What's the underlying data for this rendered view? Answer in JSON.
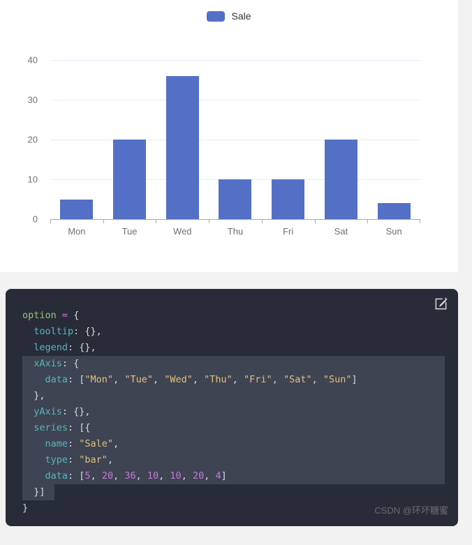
{
  "page": {
    "background": "#f2f2f2",
    "card_background": "#ffffff",
    "code_background": "#282c38",
    "selection_color": "#3e4452",
    "accent": "#5470c6"
  },
  "chart_data": {
    "type": "bar",
    "title": "",
    "subtitle": "",
    "xlabel": "",
    "ylabel": "",
    "categories": [
      "Mon",
      "Tue",
      "Wed",
      "Thu",
      "Fri",
      "Sat",
      "Sun"
    ],
    "series": [
      {
        "name": "Sale",
        "values": [
          5,
          20,
          36,
          10,
          10,
          20,
          4
        ],
        "color": "#5470c6"
      }
    ],
    "ylim": [
      0,
      40
    ],
    "yticks": [
      0,
      10,
      20,
      30,
      40
    ],
    "ytick_labels": [
      "0",
      "10",
      "20",
      "30",
      "40"
    ],
    "grid": true,
    "legend_position": "top-center",
    "legend_entries": [
      "Sale"
    ]
  },
  "legend": {
    "label": "Sale"
  },
  "code_editor": {
    "edit_icon": "edit-square-icon",
    "watermark": "CSDN @环坏糖蜜",
    "lines": [
      {
        "selected": false,
        "tokens": [
          {
            "t": "option",
            "c": "tok-var"
          },
          {
            "t": " ",
            "c": "tok-punct"
          },
          {
            "t": "=",
            "c": "tok-op"
          },
          {
            "t": " {",
            "c": "tok-brace"
          }
        ]
      },
      {
        "selected": false,
        "tokens": [
          {
            "t": "  ",
            "c": "tok-punct"
          },
          {
            "t": "tooltip",
            "c": "tok-key"
          },
          {
            "t": ": {},",
            "c": "tok-brace"
          }
        ]
      },
      {
        "selected": false,
        "tokens": [
          {
            "t": "  ",
            "c": "tok-punct"
          },
          {
            "t": "legend",
            "c": "tok-key"
          },
          {
            "t": ": {},",
            "c": "tok-brace"
          }
        ]
      },
      {
        "selected": true,
        "tokens": [
          {
            "t": "  ",
            "c": "tok-punct"
          },
          {
            "t": "xAxis",
            "c": "tok-key"
          },
          {
            "t": ": {",
            "c": "tok-brace"
          }
        ]
      },
      {
        "selected": true,
        "tokens": [
          {
            "t": "    ",
            "c": "tok-punct"
          },
          {
            "t": "data",
            "c": "tok-key"
          },
          {
            "t": ": [",
            "c": "tok-brace"
          },
          {
            "t": "\"Mon\"",
            "c": "tok-str"
          },
          {
            "t": ", ",
            "c": "tok-punct"
          },
          {
            "t": "\"Tue\"",
            "c": "tok-str"
          },
          {
            "t": ", ",
            "c": "tok-punct"
          },
          {
            "t": "\"Wed\"",
            "c": "tok-str"
          },
          {
            "t": ", ",
            "c": "tok-punct"
          },
          {
            "t": "\"Thu\"",
            "c": "tok-str"
          },
          {
            "t": ", ",
            "c": "tok-punct"
          },
          {
            "t": "\"Fri\"",
            "c": "tok-str"
          },
          {
            "t": ", ",
            "c": "tok-punct"
          },
          {
            "t": "\"Sat\"",
            "c": "tok-str"
          },
          {
            "t": ", ",
            "c": "tok-punct"
          },
          {
            "t": "\"Sun\"",
            "c": "tok-str"
          },
          {
            "t": "]",
            "c": "tok-brace"
          }
        ]
      },
      {
        "selected": true,
        "tokens": [
          {
            "t": "  },",
            "c": "tok-brace"
          }
        ]
      },
      {
        "selected": true,
        "tokens": [
          {
            "t": "  ",
            "c": "tok-punct"
          },
          {
            "t": "yAxis",
            "c": "tok-key"
          },
          {
            "t": ": {},",
            "c": "tok-brace"
          }
        ]
      },
      {
        "selected": true,
        "tokens": [
          {
            "t": "  ",
            "c": "tok-punct"
          },
          {
            "t": "series",
            "c": "tok-key"
          },
          {
            "t": ": [{",
            "c": "tok-brace"
          }
        ]
      },
      {
        "selected": true,
        "tokens": [
          {
            "t": "    ",
            "c": "tok-punct"
          },
          {
            "t": "name",
            "c": "tok-key"
          },
          {
            "t": ": ",
            "c": "tok-brace"
          },
          {
            "t": "\"Sale\"",
            "c": "tok-str"
          },
          {
            "t": ",",
            "c": "tok-punct"
          }
        ]
      },
      {
        "selected": true,
        "tokens": [
          {
            "t": "    ",
            "c": "tok-punct"
          },
          {
            "t": "type",
            "c": "tok-key"
          },
          {
            "t": ": ",
            "c": "tok-brace"
          },
          {
            "t": "\"bar\"",
            "c": "tok-str"
          },
          {
            "t": ",",
            "c": "tok-punct"
          }
        ]
      },
      {
        "selected": true,
        "tokens": [
          {
            "t": "    ",
            "c": "tok-punct"
          },
          {
            "t": "data",
            "c": "tok-key"
          },
          {
            "t": ": [",
            "c": "tok-brace"
          },
          {
            "t": "5",
            "c": "tok-num"
          },
          {
            "t": ", ",
            "c": "tok-punct"
          },
          {
            "t": "20",
            "c": "tok-num"
          },
          {
            "t": ", ",
            "c": "tok-punct"
          },
          {
            "t": "36",
            "c": "tok-num"
          },
          {
            "t": ", ",
            "c": "tok-punct"
          },
          {
            "t": "10",
            "c": "tok-num"
          },
          {
            "t": ", ",
            "c": "tok-punct"
          },
          {
            "t": "10",
            "c": "tok-num"
          },
          {
            "t": ", ",
            "c": "tok-punct"
          },
          {
            "t": "20",
            "c": "tok-num"
          },
          {
            "t": ", ",
            "c": "tok-punct"
          },
          {
            "t": "4",
            "c": "tok-num"
          },
          {
            "t": "]",
            "c": "tok-brace"
          }
        ]
      },
      {
        "selected": true,
        "short": true,
        "tokens": [
          {
            "t": "  }]",
            "c": "tok-brace"
          }
        ]
      },
      {
        "selected": false,
        "tokens": [
          {
            "t": "}",
            "c": "tok-brace"
          }
        ]
      }
    ]
  }
}
